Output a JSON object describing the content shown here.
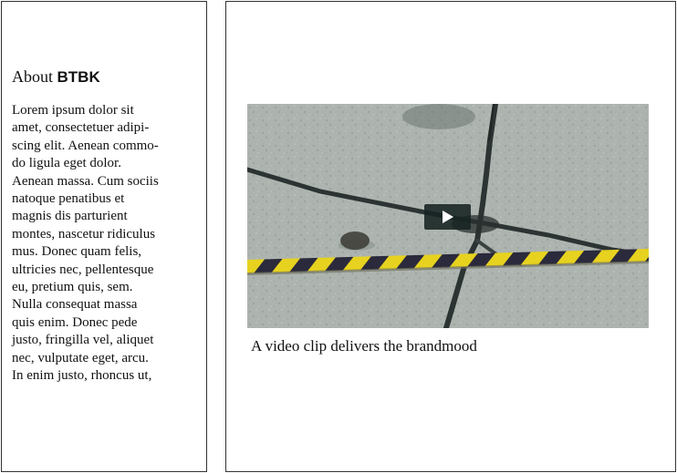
{
  "sidebar": {
    "title_prefix": "About ",
    "title_brand": "BTBK",
    "body_lines": [
      "Lorem ipsum dolor sit",
      "amet, consectetuer adipi-",
      "scing elit. Aenean commo-",
      "do ligula eget dolor.",
      "Aenean massa. Cum sociis",
      "natoque penatibus et",
      "magnis dis parturient",
      "montes, nascetur ridiculus",
      "mus. Donec quam felis,",
      "ultricies nec, pellentesque",
      "eu, pretium quis, sem.",
      "Nulla consequat massa",
      "quis enim. Donec pede",
      "justo, fringilla vel, aliquet",
      "nec, vulputate eget, arcu.",
      "In enim justo, rhoncus ut,"
    ]
  },
  "main": {
    "video": {
      "play_icon": "play-icon",
      "caption": "A video clip delivers the brandmood"
    }
  },
  "colors": {
    "border": "#333333",
    "tape_yellow": "#e7d21f",
    "tape_dark": "#2b2a3c",
    "pavement": "#a9b1ac"
  }
}
